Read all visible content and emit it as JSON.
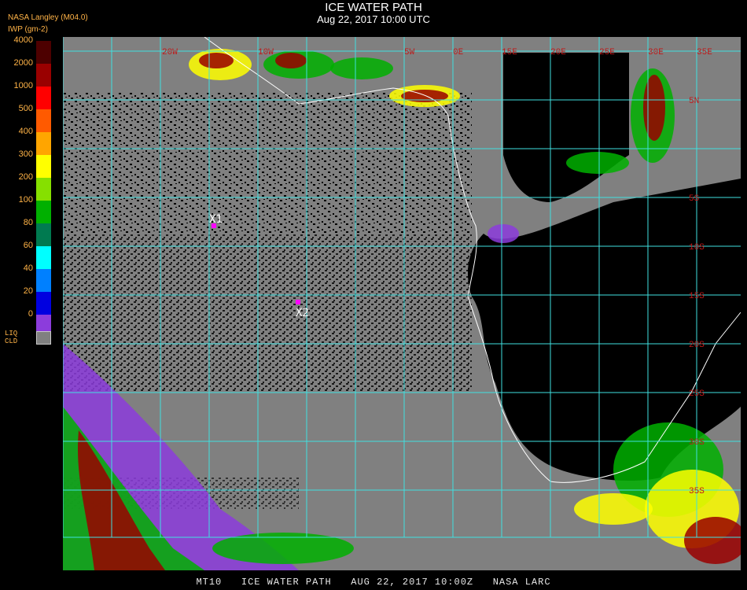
{
  "header": {
    "title": "ICE WATER PATH",
    "subtitle": "Aug 22, 2017 10:00 UTC",
    "source": "NASA Langley (M04.0)",
    "units": "IWP (gm-2)"
  },
  "legend": {
    "labels": [
      "4000",
      "2000",
      "1000",
      "500",
      "400",
      "300",
      "200",
      "100",
      "80",
      "60",
      "40",
      "20",
      "0"
    ],
    "colors": [
      "#4d0000",
      "#9a0000",
      "#ff0000",
      "#ff5a00",
      "#ffa500",
      "#ffff00",
      "#86e000",
      "#00b000",
      "#007a50",
      "#00ffff",
      "#0080ff",
      "#0000e0",
      "#8c3cdc"
    ],
    "liquid_label": [
      "LIQ",
      "CLD"
    ],
    "liquid_color": "#808080"
  },
  "map": {
    "ocean_color": "#808080",
    "clear_color": "#000000",
    "grid_color": "#40e0e0",
    "coast_color": "#ffffff",
    "lon_labels": [
      "20W",
      "10W",
      "5W",
      "0E",
      "15E",
      "20E",
      "25E",
      "30E",
      "35E"
    ],
    "lat_labels": [
      "5N",
      "5S",
      "10S",
      "15S",
      "20S",
      "25S",
      "30S",
      "35S"
    ],
    "markers": [
      {
        "label": "X1",
        "color": "#ff00ff"
      },
      {
        "label": "X2",
        "color": "#ff00ff"
      }
    ]
  },
  "footer": "MT10   ICE WATER PATH   AUG 22, 2017 10:00Z   NASA LARC"
}
